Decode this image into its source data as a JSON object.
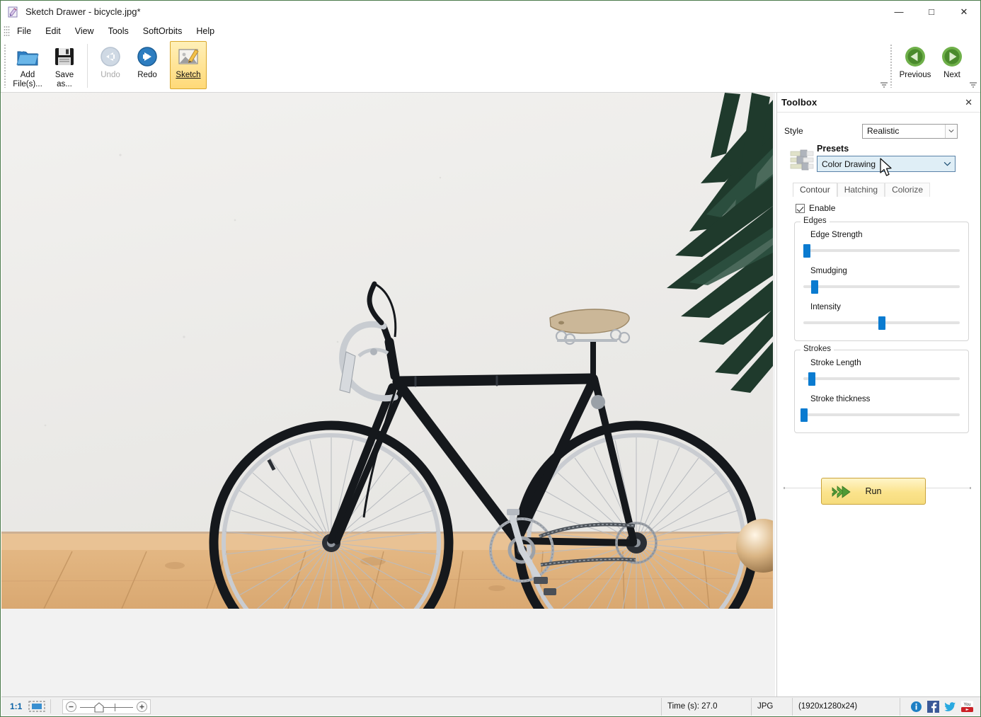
{
  "window": {
    "title": "Sketch Drawer - bicycle.jpg*",
    "app_icon": "sketch-app-icon",
    "controls": {
      "minimize": "—",
      "maximize": "□",
      "close": "✕"
    }
  },
  "menu": {
    "items": [
      {
        "label": "File",
        "accel": "F"
      },
      {
        "label": "Edit",
        "accel": "E"
      },
      {
        "label": "View",
        "accel": "V"
      },
      {
        "label": "Tools",
        "accel": "T"
      },
      {
        "label": "SoftOrbits",
        "accel": ""
      },
      {
        "label": "Help",
        "accel": "H"
      }
    ]
  },
  "ribbon": {
    "buttons": [
      {
        "name": "add-files",
        "label": "Add\nFile(s)...",
        "icon": "folder-add-icon",
        "state": "normal"
      },
      {
        "name": "save-as",
        "label": "Save\nas...",
        "icon": "floppy-disk-icon",
        "state": "normal"
      },
      {
        "name": "undo",
        "label": "Undo",
        "icon": "arrow-left-circle-icon",
        "state": "disabled"
      },
      {
        "name": "redo",
        "label": "Redo",
        "icon": "arrow-right-circle-icon",
        "state": "normal"
      },
      {
        "name": "sketch",
        "label": "Sketch",
        "icon": "sketch-pencil-icon",
        "state": "selected"
      }
    ],
    "nav": [
      {
        "name": "previous",
        "label": "Previous",
        "icon": "prev-circle-icon"
      },
      {
        "name": "next",
        "label": "Next",
        "icon": "next-circle-icon"
      }
    ],
    "overflow_glyph": "═"
  },
  "toolbox": {
    "title": "Toolbox",
    "close_glyph": "✕",
    "style": {
      "label": "Style",
      "value": "Realistic"
    },
    "presets": {
      "label": "Presets",
      "value": "Color Drawing",
      "icon": "sliders-preset-icon"
    },
    "tabs": [
      {
        "label": "Contour",
        "active": true
      },
      {
        "label": "Hatching",
        "active": false
      },
      {
        "label": "Colorize",
        "active": false
      }
    ],
    "enable": {
      "label": "Enable",
      "checked": true
    },
    "groups": [
      {
        "title": "Edges",
        "sliders": [
          {
            "label": "Edge Strength",
            "percent": 0
          },
          {
            "label": "Smudging",
            "percent": 5
          },
          {
            "label": "Intensity",
            "percent": 48
          }
        ]
      },
      {
        "title": "Strokes",
        "sliders": [
          {
            "label": "Stroke Length",
            "percent": 3
          },
          {
            "label": "Stroke thickness",
            "percent": 0
          }
        ]
      }
    ],
    "run": {
      "label": "Run",
      "icon": "green-double-arrow-icon"
    }
  },
  "statusbar": {
    "zoom_ratio": "1:1",
    "fit_icon": "fit-to-window-icon",
    "zoom_minus": "−",
    "zoom_plus": "+",
    "time": "Time (s): 27.0",
    "format": "JPG",
    "dimensions": "(1920x1280x24)",
    "icons": [
      {
        "name": "info-icon",
        "label": "i"
      },
      {
        "name": "facebook-icon",
        "label": "f"
      },
      {
        "name": "twitter-icon",
        "label": "t"
      },
      {
        "name": "youtube-icon",
        "label": "You"
      }
    ]
  },
  "canvas": {
    "image_name": "bicycle.jpg",
    "alt": "Vintage black road bicycle leaning against a white wall on a wooden plank floor with a palm plant at the upper right"
  },
  "colors": {
    "accent_blue": "#0a7bd0",
    "selected_yellow": "#ffd978",
    "run_yellow": "#fbe38c",
    "nav_green": "#4f9a35",
    "preset_highlight": "#dfeef6"
  }
}
